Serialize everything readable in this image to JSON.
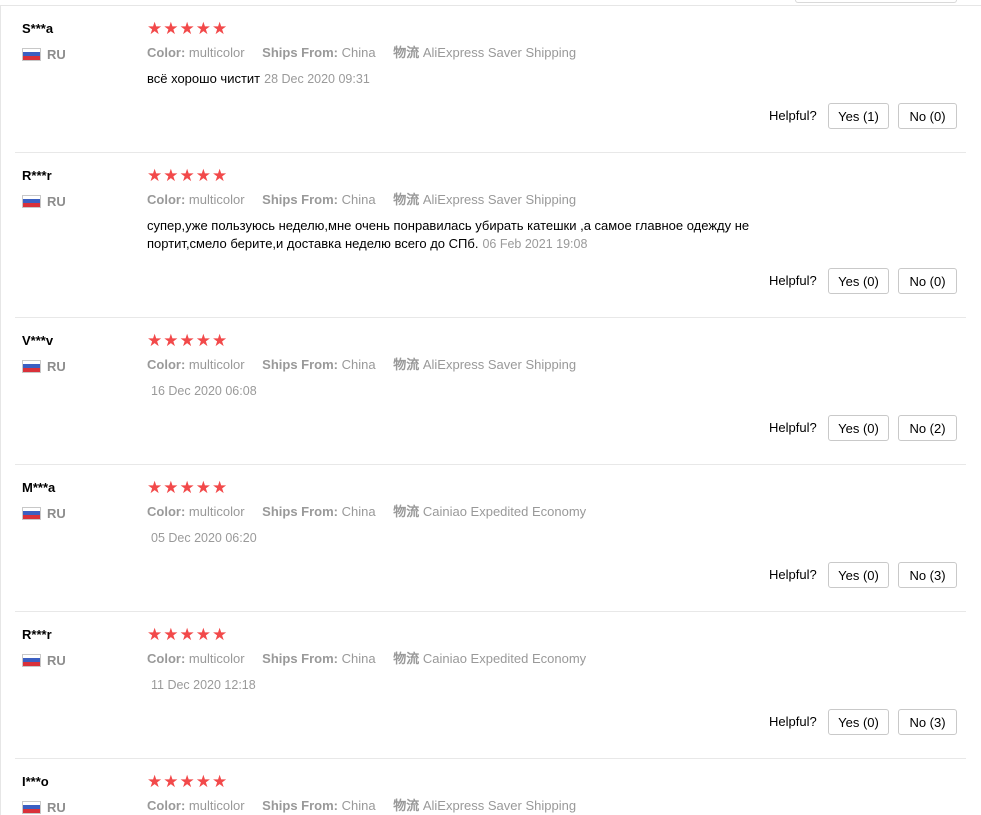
{
  "helpful_label": "Helpful?",
  "colors": {
    "star": "#f2494a",
    "meta": "#999999"
  },
  "reviews": [
    {
      "user": "S***a",
      "country": "RU",
      "stars": "★★★★★",
      "color_label": "Color:",
      "color_value": "multicolor",
      "ships_label": "Ships From:",
      "ships_value": "China",
      "logistics_label": "物流",
      "logistics_value": "AliExpress Saver Shipping",
      "text": "всё хорошо чистит",
      "date": "28 Dec 2020 09:31",
      "yes": "Yes (1)",
      "no": "No (0)"
    },
    {
      "user": "R***r",
      "country": "RU",
      "stars": "★★★★★",
      "color_label": "Color:",
      "color_value": "multicolor",
      "ships_label": "Ships From:",
      "ships_value": "China",
      "logistics_label": "物流",
      "logistics_value": "AliExpress Saver Shipping",
      "text": "супер,уже пользуюсь неделю,мне очень понравилась убирать катешки ,а самое главное одежду не портит,смело берите,и доставка неделю всего до СПб.",
      "date": "06 Feb 2021 19:08",
      "yes": "Yes (0)",
      "no": "No (0)"
    },
    {
      "user": "V***v",
      "country": "RU",
      "stars": "★★★★★",
      "color_label": "Color:",
      "color_value": "multicolor",
      "ships_label": "Ships From:",
      "ships_value": "China",
      "logistics_label": "物流",
      "logistics_value": "AliExpress Saver Shipping",
      "text": "",
      "date": "16 Dec 2020 06:08",
      "yes": "Yes (0)",
      "no": "No (2)"
    },
    {
      "user": "M***a",
      "country": "RU",
      "stars": "★★★★★",
      "color_label": "Color:",
      "color_value": "multicolor",
      "ships_label": "Ships From:",
      "ships_value": "China",
      "logistics_label": "物流",
      "logistics_value": "Cainiao Expedited Economy",
      "text": "",
      "date": "05 Dec 2020 06:20",
      "yes": "Yes (0)",
      "no": "No (3)"
    },
    {
      "user": "R***r",
      "country": "RU",
      "stars": "★★★★★",
      "color_label": "Color:",
      "color_value": "multicolor",
      "ships_label": "Ships From:",
      "ships_value": "China",
      "logistics_label": "物流",
      "logistics_value": "Cainiao Expedited Economy",
      "text": "",
      "date": "11 Dec 2020 12:18",
      "yes": "Yes (0)",
      "no": "No (3)"
    },
    {
      "user": "I***o",
      "country": "RU",
      "stars": "★★★★★",
      "color_label": "Color:",
      "color_value": "multicolor",
      "ships_label": "Ships From:",
      "ships_value": "China",
      "logistics_label": "物流",
      "logistics_value": "AliExpress Saver Shipping"
    }
  ]
}
